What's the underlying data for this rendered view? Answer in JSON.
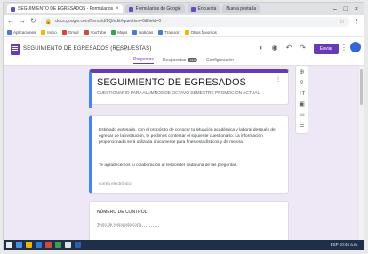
{
  "browser": {
    "tabs": [
      {
        "label": "SEGUIMIENTO DE EGRESADOS - Formularios"
      },
      {
        "label": "Formularios de Google"
      },
      {
        "label": "Encuesta"
      },
      {
        "label": "Nueva pestaña"
      }
    ],
    "url": "docs.google.com/forms/d/1Q/edit#question=0&field=0",
    "bookmarks": [
      "Aplicaciones",
      "Inicio",
      "Gmail",
      "YouTube",
      "Maps",
      "Noticias",
      "Traducir",
      "Otros favoritos"
    ]
  },
  "forms": {
    "doc_title": "SEGUIMIENTO DE EGRESADOS (RESPUESTAS)",
    "send_label": "Enviar",
    "tabs": [
      {
        "label": "Preguntas"
      },
      {
        "label": "Respuestas",
        "badge": "128"
      },
      {
        "label": "Configuración"
      }
    ]
  },
  "form": {
    "title": "SEGUIMIENTO DE EGRESADOS",
    "subtitle": "CUESTIONARIO PARA ALUMNOS DE OCTAVO SEMESTRE PROMOCIÓN ACTUAL",
    "description_1": "Estimado egresado, con el propósito de conocer tu situación académica y laboral después de egresar de la institución, te pedimos contestar el siguiente cuestionario. La información proporcionada será utilizada únicamente para fines estadísticos y de mejora.",
    "description_2": "Te agradecemos tu colaboración al responder cada una de las preguntas.",
    "email_note": "correo electrónico",
    "question": "NÚMERO DE CONTROL",
    "required_mark": "*",
    "answer_placeholder": "Texto de respuesta corta"
  },
  "taskbar": {
    "tray": "ESP  10:45 a.m."
  }
}
